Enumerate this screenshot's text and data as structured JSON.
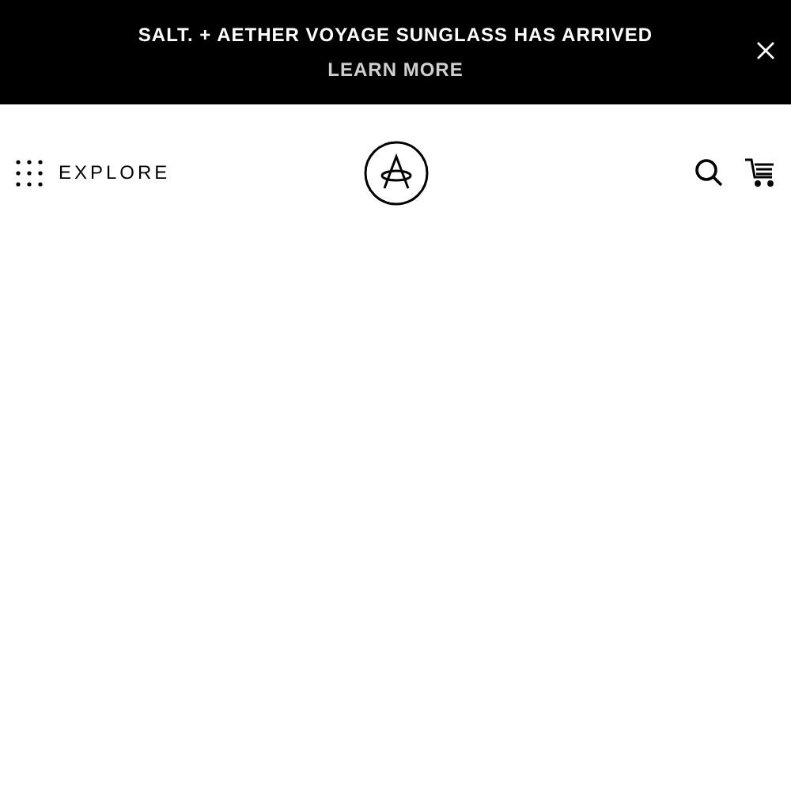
{
  "announcement": {
    "headline": "SALT. + AETHER VOYAGE SUNGLASS HAS ARRIVED",
    "link": "LEARN MORE"
  },
  "header": {
    "menu_label": "EXPLORE"
  }
}
